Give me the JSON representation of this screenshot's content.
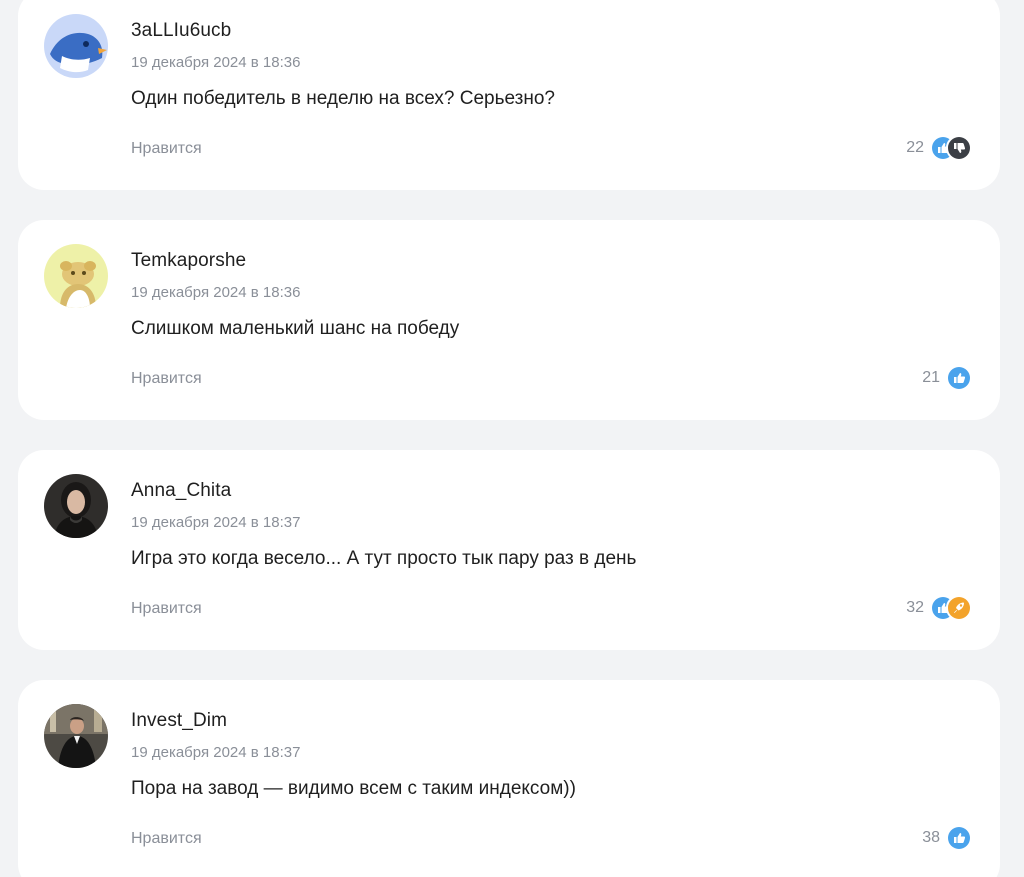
{
  "like_label": "Нравится",
  "colors": {
    "background": "#f2f3f5",
    "card": "#ffffff",
    "muted_text": "#8a8f98",
    "like_blue": "#4aa3ec",
    "dislike_dark": "#3b3f45",
    "fire_orange": "#f3a32b"
  },
  "comments": [
    {
      "author": "3aLLIu6ucb",
      "date": "19 декабря 2024 в 18:36",
      "text": "Один победитель в неделю на всех? Серьезно?",
      "count": "22",
      "reactions": [
        "thumbs-up-icon",
        "thumbs-down-icon"
      ],
      "avatar": "penguin-avatar"
    },
    {
      "author": "Temkaporshe",
      "date": "19 декабря 2024 в 18:36",
      "text": "Слишком маленький шанс на победу",
      "count": "21",
      "reactions": [
        "thumbs-up-icon"
      ],
      "avatar": "cartoon-avatar"
    },
    {
      "author": "Anna_Chita",
      "date": "19 декабря 2024 в 18:37",
      "text": "Игра это когда весело... А тут просто тык пару раз в день",
      "count": "32",
      "reactions": [
        "thumbs-up-icon",
        "rocket-icon"
      ],
      "avatar": "woman-photo-avatar"
    },
    {
      "author": "Invest_Dim",
      "date": "19 декабря 2024 в 18:37",
      "text": "Пора на завод — видимо всем с таким индексом))",
      "count": "38",
      "reactions": [
        "thumbs-up-icon"
      ],
      "avatar": "man-photo-avatar"
    }
  ]
}
